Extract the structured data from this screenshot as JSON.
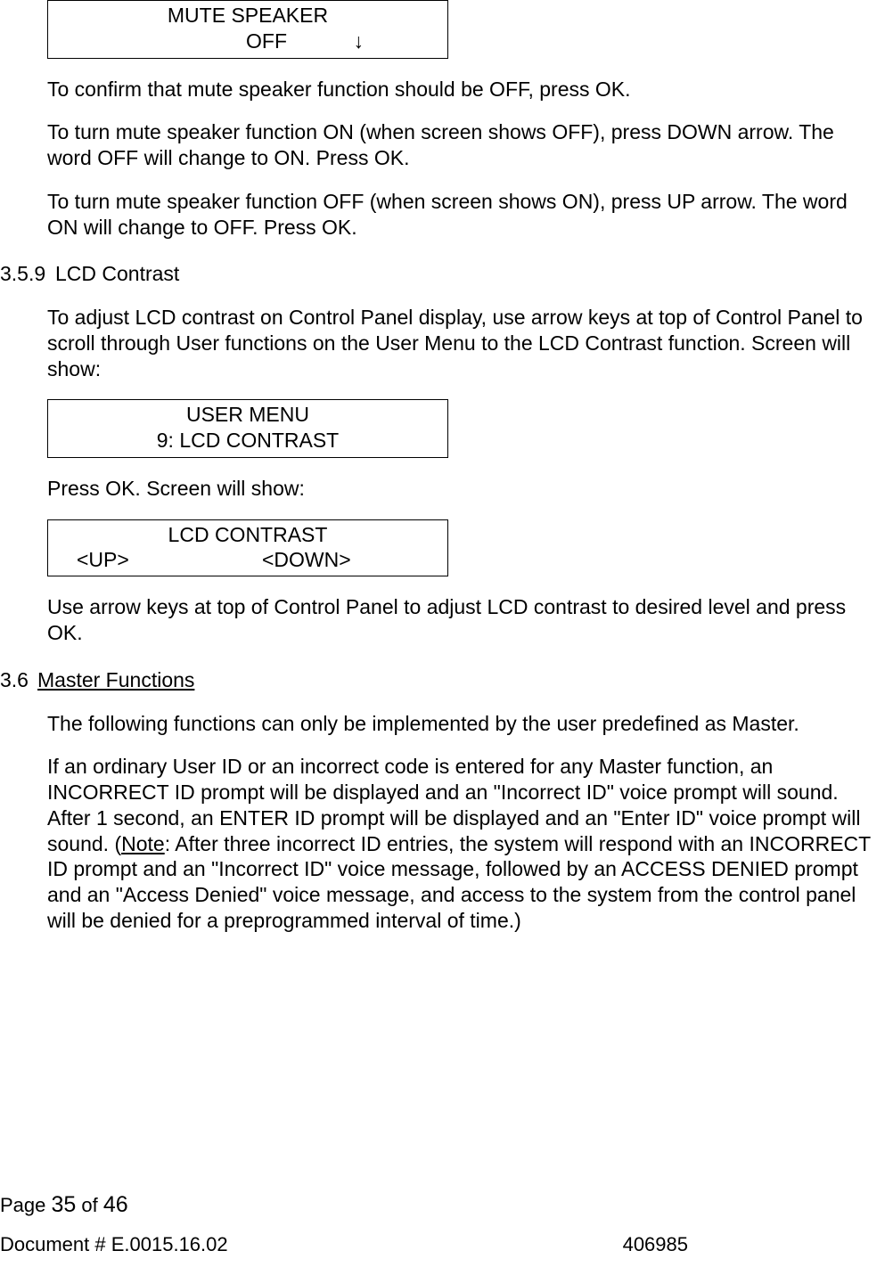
{
  "lcd1": {
    "line1": "MUTE SPEAKER",
    "off": "OFF",
    "arrow": "↓"
  },
  "p1": "To confirm that mute speaker function should be OFF, press OK.",
  "p2": "To turn mute speaker function ON (when screen shows OFF), press DOWN arrow. The word OFF will change to ON. Press OK.",
  "p3": "To turn mute speaker function OFF (when screen shows ON), press UP arrow. The word ON will change to OFF. Press OK.",
  "sec359_num": "3.5.9",
  "sec359_title": "LCD Contrast",
  "p4": "To adjust LCD contrast on Control Panel display, use arrow keys at top of Control Panel to scroll through User functions on the User Menu to the LCD Contrast function. Screen will show:",
  "lcd2": {
    "line1": "USER MENU",
    "line2": "9: LCD CONTRAST"
  },
  "p5": "Press OK. Screen will show:",
  "lcd3": {
    "line1": "LCD CONTRAST",
    "up": "<UP>",
    "down": "<DOWN>"
  },
  "p6": "Use arrow keys at top of Control Panel to adjust LCD contrast to desired level and press OK.",
  "sec36_num": "3.6",
  "sec36_title": "Master Functions",
  "p7": "The following functions can only be implemented by the user predefined as Master.",
  "p8a": "If an ordinary User ID or an incorrect code is entered for any Master function, an INCORRECT ID prompt will be displayed and an \"Incorrect ID\" voice prompt will sound. After 1 second, an ENTER ID prompt will be displayed and an \"Enter ID\" voice prompt will sound. (",
  "p8note": "Note",
  "p8b": ": After three incorrect ID entries, the system will respond with an INCORRECT ID prompt and an \"Incorrect ID\" voice message, followed by an ACCESS DENIED prompt and an \"Access Denied\" voice message, and access to the system from the control panel will be denied for a preprogrammed interval of time.)",
  "footer": {
    "page_label": "Page ",
    "page_num": "35",
    "of": "  of   ",
    "total": "46",
    "doc": "Document # E.0015.16.02",
    "rightnum": "406985"
  }
}
